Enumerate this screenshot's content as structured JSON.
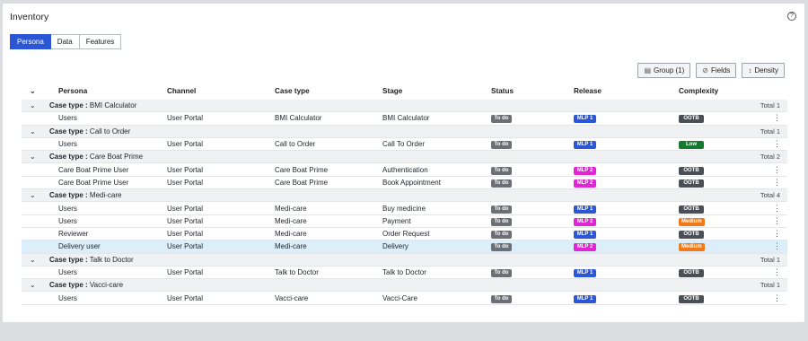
{
  "title": "Inventory",
  "help_icon": "?",
  "tabs": [
    "Persona",
    "Data",
    "Features"
  ],
  "active_tab": 0,
  "toolbar": {
    "group": "Group (1)",
    "fields": "Fields",
    "density": "Density"
  },
  "columns": [
    "Persona",
    "Channel",
    "Case type",
    "Stage",
    "Status",
    "Release",
    "Complexity"
  ],
  "groups": [
    {
      "label": "Case type :",
      "name": "BMI Calculator",
      "total": "Total 1",
      "rows": [
        {
          "persona": "Users",
          "channel": "User Portal",
          "case_type": "BMI Calculator",
          "stage": "BMI Calculator",
          "status": "To do",
          "release": "MLP 1",
          "complexity": "OOTB"
        }
      ]
    },
    {
      "label": "Case type :",
      "name": "Call to Order",
      "total": "Total 1",
      "rows": [
        {
          "persona": "Users",
          "channel": "User Portal",
          "case_type": "Call to Order",
          "stage": "Call To Order",
          "status": "To do",
          "release": "MLP 1",
          "complexity": "Low"
        }
      ]
    },
    {
      "label": "Case type :",
      "name": "Care Boat Prime",
      "total": "Total 2",
      "rows": [
        {
          "persona": "Care Boat Prime User",
          "channel": "User Portal",
          "case_type": "Care Boat Prime",
          "stage": "Authentication",
          "status": "To do",
          "release": "MLP 2",
          "complexity": "OOTB"
        },
        {
          "persona": "Care Boat Prime User",
          "channel": "User Portal",
          "case_type": "Care Boat Prime",
          "stage": "Book Appointment",
          "status": "To do",
          "release": "MLP 2",
          "complexity": "OOTB"
        }
      ]
    },
    {
      "label": "Case type :",
      "name": "Medi-care",
      "total": "Total 4",
      "rows": [
        {
          "persona": "Users",
          "channel": "User Portal",
          "case_type": "Medi-care",
          "stage": "Buy medicine",
          "status": "To do",
          "release": "MLP 1",
          "complexity": "OOTB"
        },
        {
          "persona": "Users",
          "channel": "User Portal",
          "case_type": "Medi-care",
          "stage": "Payment",
          "status": "To do",
          "release": "MLP 2",
          "complexity": "Medium"
        },
        {
          "persona": "Reviewer",
          "channel": "User Portal",
          "case_type": "Medi-care",
          "stage": "Order Request",
          "status": "To do",
          "release": "MLP 1",
          "complexity": "OOTB"
        },
        {
          "persona": "Delivery user",
          "channel": "User Portal",
          "case_type": "Medi-care",
          "stage": "Delivery",
          "status": "To do",
          "release": "MLP 2",
          "complexity": "Medium",
          "selected": true
        }
      ]
    },
    {
      "label": "Case type :",
      "name": "Talk to Doctor",
      "total": "Total 1",
      "rows": [
        {
          "persona": "Users",
          "channel": "User Portal",
          "case_type": "Talk to Doctor",
          "stage": "Talk to Doctor",
          "status": "To do",
          "release": "MLP 1",
          "complexity": "OOTB"
        }
      ]
    },
    {
      "label": "Case type :",
      "name": "Vacci-care",
      "total": "Total 1",
      "rows": [
        {
          "persona": "Users",
          "channel": "User Portal",
          "case_type": "Vacci-care",
          "stage": "Vacci-Care",
          "status": "To do",
          "release": "MLP 1",
          "complexity": "OOTB"
        }
      ]
    }
  ]
}
